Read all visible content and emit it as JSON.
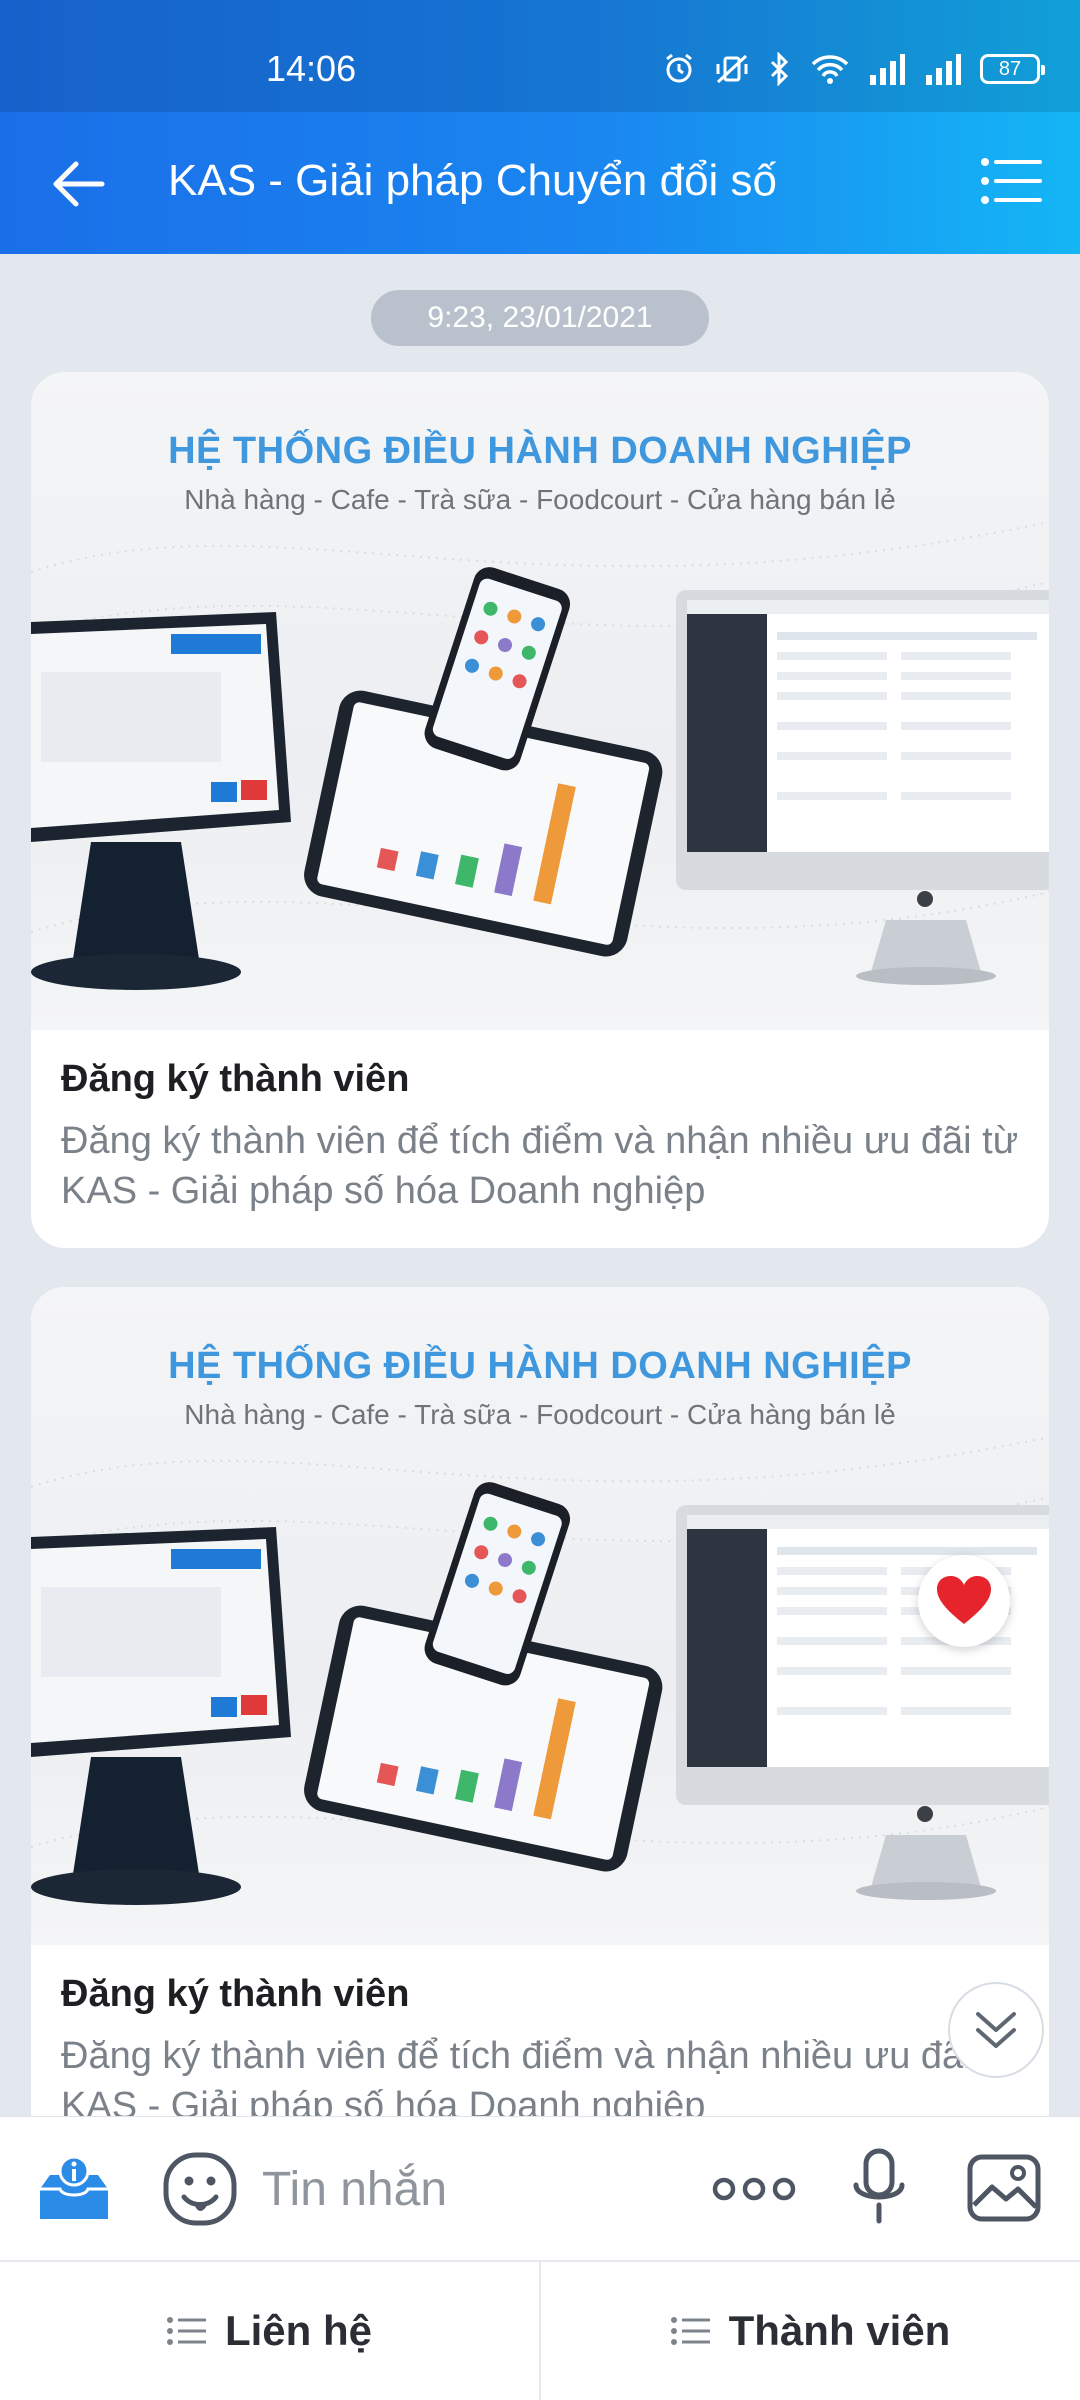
{
  "status_bar": {
    "time": "14:06",
    "battery": "87"
  },
  "header": {
    "title": "KAS - Giải pháp Chuyển đổi số"
  },
  "chat": {
    "timestamp": "9:23, 23/01/2021",
    "cards": [
      {
        "banner_title": "HỆ THỐNG ĐIỀU HÀNH DOANH NGHIỆP",
        "banner_subtitle": "Nhà hàng - Cafe - Trà sữa - Foodcourt - Cửa hàng bán lẻ",
        "title": "Đăng ký thành viên",
        "description": "Đăng ký thành viên để tích điểm và nhận nhiều ưu đãi từ KAS - Giải pháp số hóa Doanh nghiệp"
      },
      {
        "banner_title": "HỆ THỐNG ĐIỀU HÀNH DOANH NGHIỆP",
        "banner_subtitle": "Nhà hàng - Cafe - Trà sữa - Foodcourt - Cửa hàng bán lẻ",
        "title": "Đăng ký thành viên",
        "description": "Đăng ký thành viên để tích điểm và nhận nhiều ưu đãi từ KAS - Giải pháp số hóa Doanh nghiệp"
      }
    ]
  },
  "input_bar": {
    "placeholder": "Tin nhắn"
  },
  "bottom_tabs": [
    {
      "label": "Liên hệ"
    },
    {
      "label": "Thành viên"
    }
  ],
  "colors": {
    "header_gradient_start": "#1a6fe8",
    "header_gradient_end": "#14b6f5",
    "accent": "#1a86f0",
    "heart": "#e6242c"
  }
}
